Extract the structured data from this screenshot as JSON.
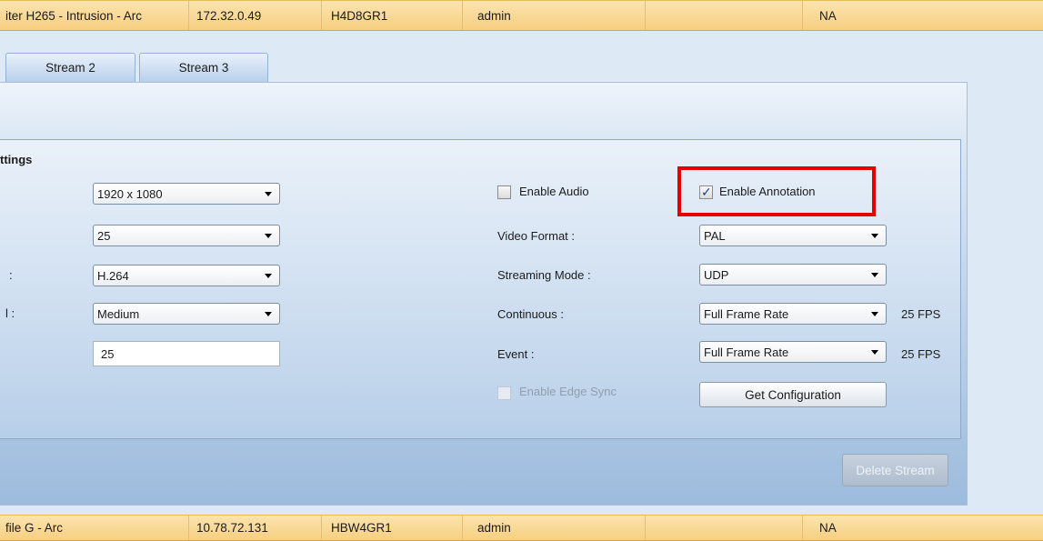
{
  "rows": {
    "top": {
      "name": "iter H265 - Intrusion - Arc",
      "ip": "172.32.0.49",
      "serial": "H4D8GR1",
      "user": "admin",
      "blank": "",
      "status": "NA"
    },
    "bottom": {
      "name": "file G - Arc",
      "ip": "10.78.72.131",
      "serial": "HBW4GR1",
      "user": "admin",
      "blank": "",
      "status": "NA"
    }
  },
  "tabs": [
    {
      "label": "Stream 2"
    },
    {
      "label": "Stream 3"
    }
  ],
  "settings": {
    "title": "ttings",
    "left": {
      "resolution": "1920 x 1080",
      "framerate": "25",
      "codec_label": ":",
      "codec": "H.264",
      "quality_label": "l :",
      "quality": "Medium",
      "value": "25"
    },
    "right": {
      "enable_audio": {
        "label": "Enable Audio",
        "checked": false
      },
      "enable_annotation": {
        "label": "Enable Annotation",
        "checked": true
      },
      "video_format": {
        "label": "Video Format :",
        "value": "PAL"
      },
      "streaming_mode": {
        "label": "Streaming Mode :",
        "value": "UDP"
      },
      "continuous": {
        "label": "Continuous :",
        "value": "Full Frame Rate",
        "fps": "25 FPS"
      },
      "event": {
        "label": "Event :",
        "value": "Full Frame Rate",
        "fps": "25 FPS"
      },
      "enable_edge_sync": {
        "label": "Enable Edge Sync",
        "checked": false,
        "disabled": true
      },
      "get_configuration": "Get Configuration"
    }
  },
  "delete_stream": "Delete Stream",
  "colors": {
    "highlight": "#e60000",
    "row_bg": "#f7cf7f",
    "panel": "#b3cbe6"
  }
}
